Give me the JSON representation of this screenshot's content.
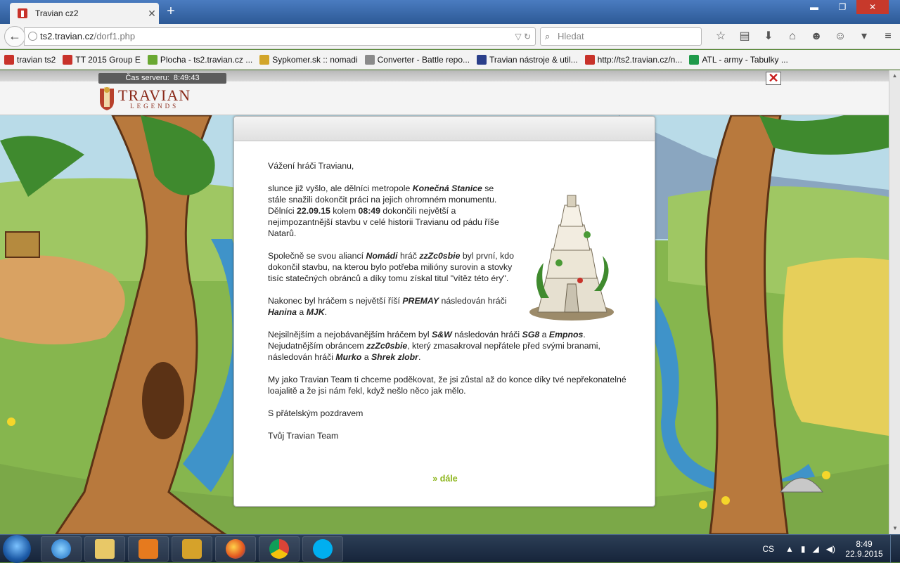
{
  "browser": {
    "tab_title": "Travian cz2",
    "tab_close": "✕",
    "new_tab": "+",
    "window_controls": [
      "▬",
      "❐",
      "✕"
    ],
    "url_domain": "ts2.travian.cz",
    "url_path": "/dorf1.php",
    "search_placeholder": "Hledat",
    "bookmarks": [
      {
        "label": "travian ts2",
        "color": "#c8322a"
      },
      {
        "label": "TT 2015 Group E",
        "color": "#c8322a"
      },
      {
        "label": "Plocha - ts2.travian.cz ...",
        "color": "#6aa832"
      },
      {
        "label": "Sypkomer.sk :: nomadi",
        "color": "#d2a52a"
      },
      {
        "label": "Converter - Battle repo...",
        "color": "#8a8a8a"
      },
      {
        "label": "Travian nástroje & util...",
        "color": "#2a3f8a"
      },
      {
        "label": "http://ts2.travian.cz/n...",
        "color": "#c8322a"
      },
      {
        "label": "ATL - army - Tabulky ...",
        "color": "#1f9a4a"
      }
    ]
  },
  "game": {
    "server_time_label": "Čas serveru:",
    "server_time": "8:49:43",
    "logo_title": "TRAVIAN",
    "logo_subtitle": "LEGENDS",
    "close_symbol": "✕"
  },
  "message": {
    "greeting": "Vážení hráči Travianu,",
    "p1_a": "slunce již vyšlo, ale dělníci metropole ",
    "p1_city": "Konečná Stanice",
    "p1_b": " se stále snažili dokončit práci na jejich ohromném monumentu. Dělníci ",
    "p1_date": "22.09.15",
    "p1_c": " kolem ",
    "p1_time": "08:49",
    "p1_d": " dokončili největší a nejimpozantnější stavbu v celé historii Travianu od pádu říše Natarů.",
    "p2_a": "Společně se svou aliancí ",
    "p2_alliance": "Nomádi",
    "p2_b": " hráč ",
    "p2_player": "zzZc0sbie",
    "p2_c": " byl první, kdo dokončil stavbu, na kterou bylo potřeba milióny surovin a stovky tisíc statečných obránců a díky tomu získal titul \"vítěz této éry\".",
    "p3_a": "Nakonec byl hráčem s největší říší ",
    "p3_first": "PREMAY",
    "p3_b": " následován hráči ",
    "p3_second": "Hanina",
    "p3_c": " a ",
    "p3_third": "MJK",
    "p3_d": ".",
    "p4_a": "Nejsilnějším a nejobávanějším hráčem byl ",
    "p4_first": "S&W",
    "p4_b": " následován hráči ",
    "p4_second": "SG8",
    "p4_c": " a ",
    "p4_third": "Empnos",
    "p4_d": ". Nejudatnějším obráncem ",
    "p4_def": "zzZc0sbie",
    "p4_e": ", který zmasakroval nepřátele před svými branami, následován hráči ",
    "p4_def2": "Murko",
    "p4_f": " a ",
    "p4_def3": "Shrek zlobr",
    "p4_g": ".",
    "p5": "My jako Travian Team ti chceme poděkovat, že jsi zůstal až do konce díky tvé nepřekonatelné loajalitě a že jsi nám řekl, když nešlo něco jak mělo.",
    "closing": "S přátelským pozdravem",
    "signature": "Tvůj Travian Team",
    "continue_link": "» dále"
  },
  "taskbar": {
    "lang": "CS",
    "time": "8:49",
    "date": "22.9.2015",
    "tray_icons": [
      "▲",
      "▮",
      "◢",
      "◀)"
    ]
  },
  "colors": {
    "link_green": "#8cb51a",
    "logo_red": "#8a2a1a",
    "close_red": "#c81e1e"
  }
}
